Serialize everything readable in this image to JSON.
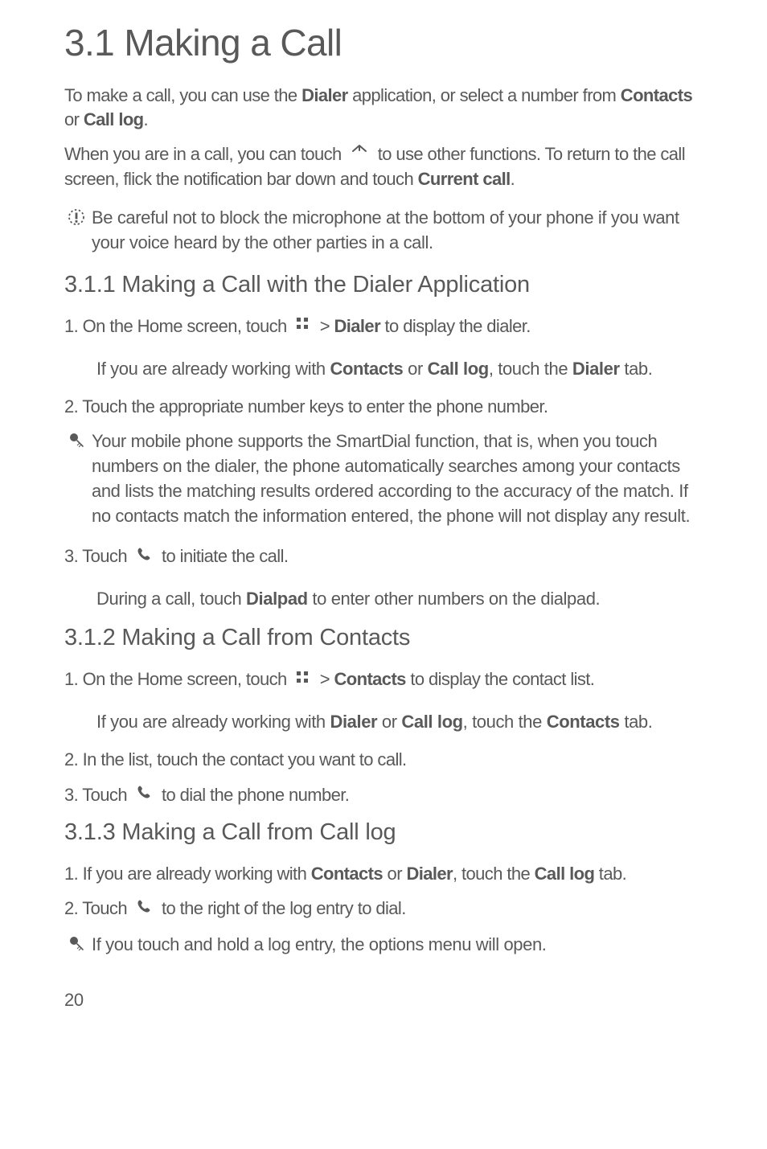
{
  "h1": "3.1  Making a Call",
  "intro1_pre": "To make a call, you can use the ",
  "intro1_b1": "Dialer",
  "intro1_mid1": " application, or select a number from ",
  "intro1_b2": "Contacts",
  "intro1_mid2": " or ",
  "intro1_b3": "Call log",
  "intro1_post": ".",
  "intro2_pre": "When you are in a call, you can touch ",
  "intro2_mid": " to use other functions. To return to the call screen, flick the notification bar down and touch ",
  "intro2_b1": "Current call",
  "intro2_post": ".",
  "note1": "Be careful not to block the microphone at the bottom of your phone if you want your voice heard by the other parties in a call.",
  "s311": {
    "title": "3.1.1  Making a Call with the Dialer Application",
    "step1_pre": "1. On the Home screen, touch ",
    "step1_mid": " > ",
    "step1_b1": "Dialer",
    "step1_post": " to display the dialer.",
    "step1_indent_pre": "If you are already working with ",
    "step1_indent_b1": "Contacts",
    "step1_indent_mid1": " or ",
    "step1_indent_b2": "Call log",
    "step1_indent_mid2": ", touch the ",
    "step1_indent_b3": "Dialer",
    "step1_indent_post": " tab.",
    "step2": "2. Touch the appropriate number keys to enter the phone number.",
    "tip": "Your mobile phone supports the SmartDial function, that is, when you touch numbers on the dialer, the phone automatically searches among your contacts and lists the matching results ordered according to the accuracy of the match. If no contacts match the information entered, the phone will not display any result.",
    "step3_pre": "3. Touch ",
    "step3_post": " to initiate the call.",
    "step3_indent_pre": "During a call, touch ",
    "step3_indent_b1": "Dialpad",
    "step3_indent_post": " to enter other numbers on the dialpad."
  },
  "s312": {
    "title": "3.1.2  Making a Call from Contacts",
    "step1_pre": "1. On the Home screen, touch ",
    "step1_mid": " > ",
    "step1_b1": "Contacts",
    "step1_post": " to display the contact list.",
    "step1_indent_pre": "If you are already working with ",
    "step1_indent_b1": "Dialer",
    "step1_indent_mid1": " or ",
    "step1_indent_b2": "Call log",
    "step1_indent_mid2": ", touch the ",
    "step1_indent_b3": "Contacts",
    "step1_indent_post": " tab.",
    "step2": "2. In the list, touch the contact you want to call.",
    "step3_pre": "3. Touch ",
    "step3_post": " to dial the phone number."
  },
  "s313": {
    "title": "3.1.3  Making a Call from Call log",
    "step1_pre": "1. If you are already working with ",
    "step1_b1": "Contacts",
    "step1_mid1": " or ",
    "step1_b2": "Dialer",
    "step1_mid2": ", touch the ",
    "step1_b3": "Call log",
    "step1_post": " tab.",
    "step2_pre": "2. Touch ",
    "step2_post": " to the right of the log entry to dial.",
    "tip": "If you touch and hold a log entry, the options menu will open."
  },
  "page_number": "20"
}
